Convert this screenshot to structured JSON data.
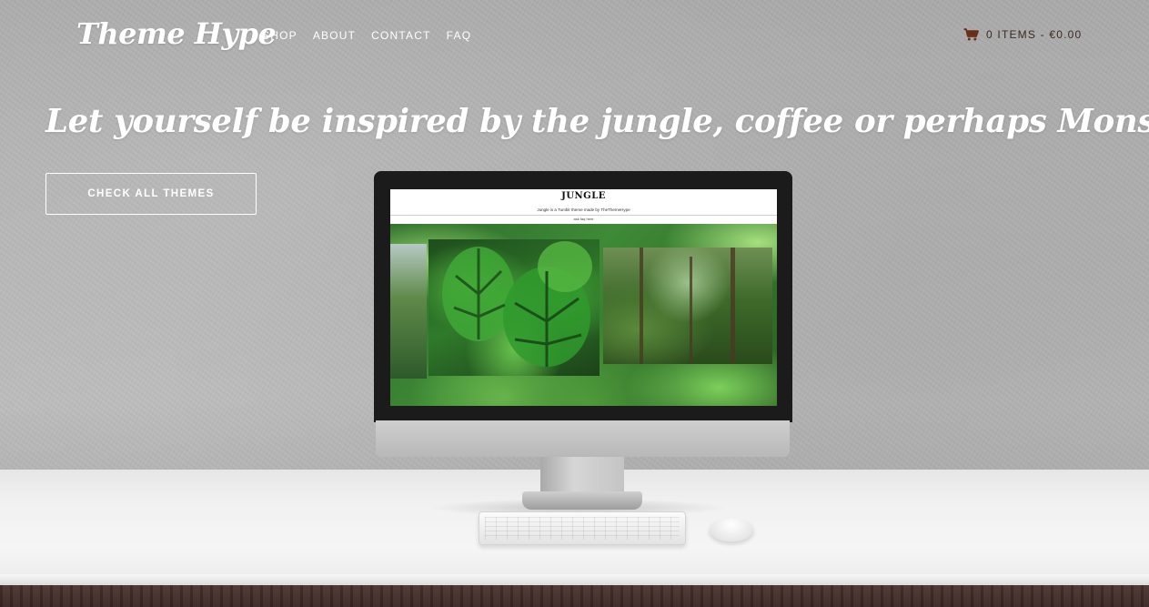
{
  "header": {
    "logo": "Theme Hype",
    "nav": [
      "SHOP",
      "ABOUT",
      "CONTACT",
      "FAQ"
    ],
    "cart": {
      "icon": "cart-icon",
      "label": "0 ITEMS - €0.00"
    }
  },
  "hero": {
    "headline": "Let yourself be inspired by the jungle, coffee or perhaps Monstera Deliciosa",
    "cta": "CHECK ALL THEMES"
  },
  "screen": {
    "title": "JUNGLE",
    "subtitle": "Jungle is a Tumblr theme made by TheThemeHype",
    "nav": "ask  faq  here"
  },
  "colors": {
    "cart_text": "#3a2a22",
    "cart_icon": "#6a2e16",
    "text": "#ffffff"
  }
}
